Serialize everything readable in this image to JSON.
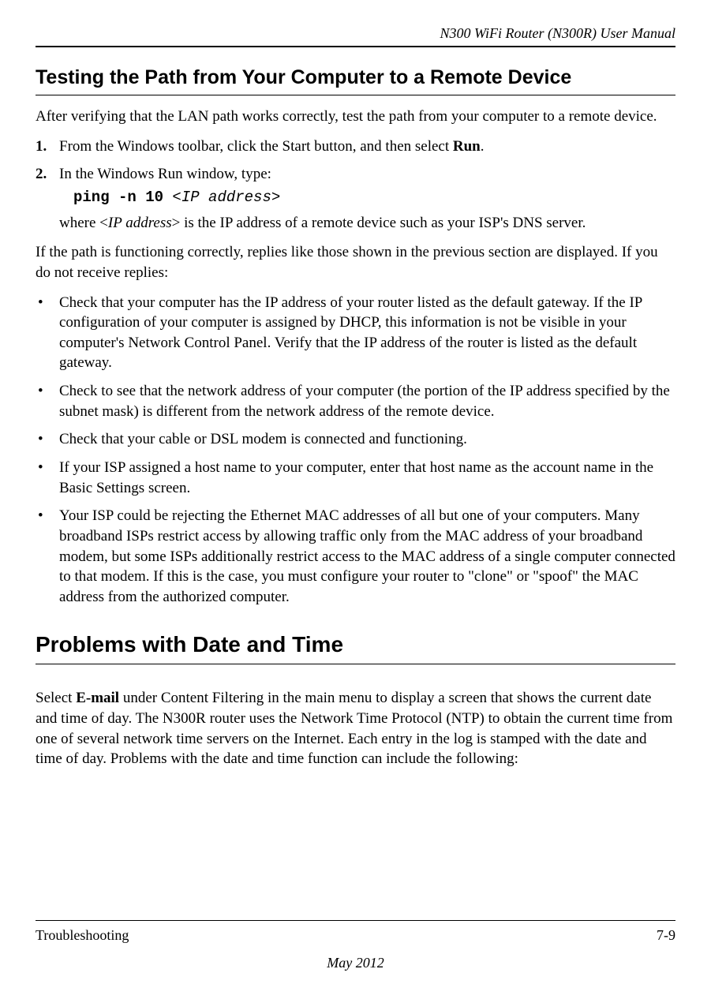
{
  "header": {
    "title": "N300 WiFi Router (N300R) User Manual"
  },
  "section1": {
    "heading": "Testing the Path from Your Computer to a Remote Device",
    "intro": "After verifying that the LAN path works correctly, test the path from your computer to a remote device.",
    "steps": [
      {
        "num": "1.",
        "text_before": "From the Windows toolbar, click the Start button, and then select ",
        "bold": "Run",
        "text_after": "."
      },
      {
        "num": "2.",
        "text": "In the Windows Run window, type:",
        "code_bold": "ping -n 10",
        "code_ital": " <IP address>",
        "sub_before": "where <",
        "sub_ital": "IP address",
        "sub_after": "> is the IP address of a remote device such as your ISP's DNS server."
      }
    ],
    "para2": "If the path is functioning correctly, replies like those shown in the previous section are displayed. If you do not receive replies:",
    "bullets": [
      "Check that your computer has the IP address of your router listed as the default gateway. If the IP configuration of your computer is assigned by DHCP, this information is not be visible in your computer's Network Control Panel. Verify that the IP address of the router is listed as the default gateway.",
      "Check to see that the network address of your computer (the portion of the IP address specified by the subnet mask) is different from the network address of the remote device.",
      "Check that your cable or DSL modem is connected and functioning.",
      "If your ISP assigned a host name to your computer, enter that host name as the account name in the Basic Settings screen.",
      "Your ISP could be rejecting the Ethernet MAC addresses of all but one of your computers. Many broadband ISPs restrict access by allowing traffic only from the MAC address of your broadband modem, but some ISPs additionally restrict access to the MAC address of a single computer connected to that modem. If this is the case, you must configure your router to \"clone\" or \"spoof\" the MAC address from the authorized computer."
    ]
  },
  "section2": {
    "heading": "Problems with Date and Time",
    "para_before": "Select ",
    "para_bold": "E-mail",
    "para_after": " under Content Filtering in the main menu to display a screen that shows the current date and time of day. The N300R router uses the Network Time Protocol (NTP) to obtain the current time from one of several network time servers on the Internet. Each entry in the log is stamped with the date and time of day. Problems with the date and time function can include the following:"
  },
  "footer": {
    "left": "Troubleshooting",
    "right": "7-9",
    "date": "May 2012"
  }
}
